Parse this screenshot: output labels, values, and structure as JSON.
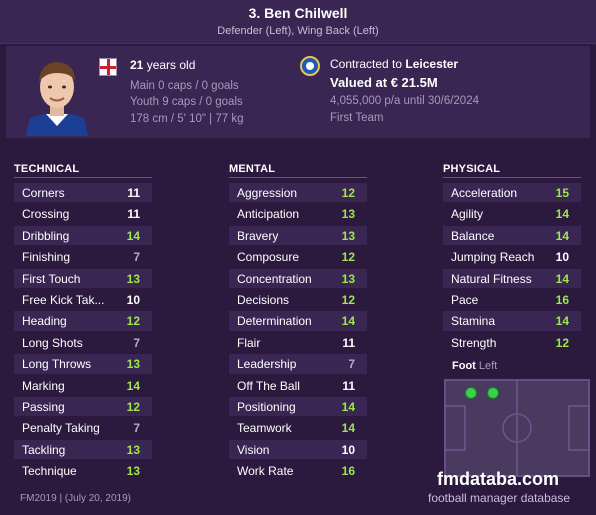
{
  "header": {
    "name": "3. Ben Chilwell",
    "positions": "Defender (Left), Wing Back (Left)"
  },
  "player": {
    "age_number": "21",
    "age_suffix": "years old",
    "main_caps": "Main 0 caps / 0 goals",
    "youth_caps": "Youth 9 caps / 0 goals",
    "physique": "178 cm / 5' 10\" | 77 kg",
    "nationality_flag": "england-flag-icon"
  },
  "contract": {
    "prefix": "Contracted to",
    "club": "Leicester",
    "valued": "Valued at € 21.5M",
    "wage": "4,055,000 p/a until 30/6/2024",
    "team": "First Team",
    "club_badge": "leicester-badge-icon"
  },
  "colors": {
    "high": "#9ee84a",
    "mid": "#ffffff",
    "low": "#b8a9c8"
  },
  "technical": {
    "title": "TECHNICAL",
    "rows": [
      {
        "label": "Corners",
        "value": "11"
      },
      {
        "label": "Crossing",
        "value": "11"
      },
      {
        "label": "Dribbling",
        "value": "14"
      },
      {
        "label": "Finishing",
        "value": "7"
      },
      {
        "label": "First Touch",
        "value": "13"
      },
      {
        "label": "Free Kick Tak...",
        "value": "10"
      },
      {
        "label": "Heading",
        "value": "12"
      },
      {
        "label": "Long Shots",
        "value": "7"
      },
      {
        "label": "Long Throws",
        "value": "13"
      },
      {
        "label": "Marking",
        "value": "14"
      },
      {
        "label": "Passing",
        "value": "12"
      },
      {
        "label": "Penalty Taking",
        "value": "7"
      },
      {
        "label": "Tackling",
        "value": "13"
      },
      {
        "label": "Technique",
        "value": "13"
      }
    ]
  },
  "mental": {
    "title": "MENTAL",
    "rows": [
      {
        "label": "Aggression",
        "value": "12"
      },
      {
        "label": "Anticipation",
        "value": "13"
      },
      {
        "label": "Bravery",
        "value": "13"
      },
      {
        "label": "Composure",
        "value": "12"
      },
      {
        "label": "Concentration",
        "value": "13"
      },
      {
        "label": "Decisions",
        "value": "12"
      },
      {
        "label": "Determination",
        "value": "14"
      },
      {
        "label": "Flair",
        "value": "11"
      },
      {
        "label": "Leadership",
        "value": "7"
      },
      {
        "label": "Off The Ball",
        "value": "11"
      },
      {
        "label": "Positioning",
        "value": "14"
      },
      {
        "label": "Teamwork",
        "value": "14"
      },
      {
        "label": "Vision",
        "value": "10"
      },
      {
        "label": "Work Rate",
        "value": "16"
      }
    ]
  },
  "physical": {
    "title": "PHYSICAL",
    "rows": [
      {
        "label": "Acceleration",
        "value": "15"
      },
      {
        "label": "Agility",
        "value": "14"
      },
      {
        "label": "Balance",
        "value": "14"
      },
      {
        "label": "Jumping Reach",
        "value": "10"
      },
      {
        "label": "Natural Fitness",
        "value": "14"
      },
      {
        "label": "Pace",
        "value": "16"
      },
      {
        "label": "Stamina",
        "value": "14"
      },
      {
        "label": "Strength",
        "value": "12"
      }
    ]
  },
  "foot": {
    "label": "Foot",
    "value": "Left"
  },
  "branding": {
    "site": "fmdataba.com",
    "tagline": "football manager database"
  },
  "footer": {
    "version": "FM2019 | (July 20, 2019)"
  }
}
